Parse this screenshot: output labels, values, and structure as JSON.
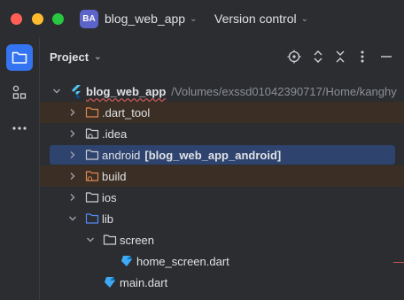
{
  "titlebar": {
    "badge": "BA",
    "badge_color": "#5c63c9",
    "project_name": "blog_web_app",
    "vcs_label": "Version control",
    "traffic_colors": {
      "close": "#ff5f57",
      "minimize": "#febc2e",
      "zoom": "#28c840"
    }
  },
  "toolstrip": {
    "items": [
      {
        "icon": "folder-icon",
        "active": true
      },
      {
        "icon": "structure-icon",
        "active": false
      },
      {
        "icon": "more-icon",
        "active": false
      }
    ]
  },
  "panel": {
    "title": "Project",
    "header_icons": [
      "locate-icon",
      "expand-icon",
      "collapse-icon",
      "more-vertical-icon",
      "minimize-icon"
    ]
  },
  "tree": {
    "root": {
      "name": "blog_web_app",
      "path": "/Volumes/exssd01042390717/Home/kanghy"
    },
    "rows": [
      {
        "label": ".dart_tool",
        "kind": "folder-excluded"
      },
      {
        "label": ".idea",
        "kind": "folder-config"
      },
      {
        "label": "android",
        "module": "[blog_web_app_android]",
        "kind": "folder",
        "selected": true
      },
      {
        "label": "build",
        "kind": "folder-excluded"
      },
      {
        "label": "ios",
        "kind": "folder"
      },
      {
        "label": "lib",
        "kind": "folder-source"
      },
      {
        "label": "screen",
        "kind": "folder"
      },
      {
        "label": "home_screen.dart",
        "kind": "dart-file"
      },
      {
        "label": "main.dart",
        "kind": "dart-file"
      }
    ]
  },
  "colors": {
    "accent": "#3574f0",
    "selection": "#2e436e",
    "excluded_row": "#3b2f25"
  }
}
